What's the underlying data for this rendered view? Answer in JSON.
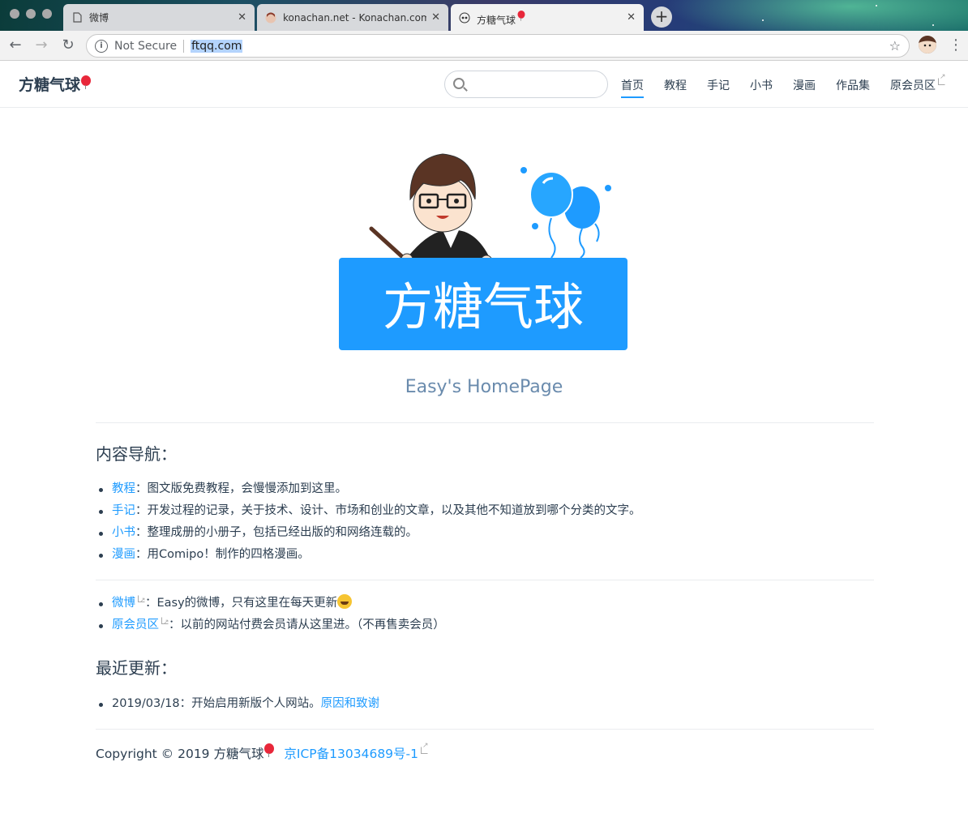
{
  "browser": {
    "tabs": [
      {
        "title": "微博",
        "active": false
      },
      {
        "title": "konachan.net - Konachan.com",
        "active": false
      },
      {
        "title": "方糖气球",
        "active": true
      }
    ],
    "security_label": "Not Secure",
    "url": "ftqq.com"
  },
  "header": {
    "site_title": "方糖气球",
    "search_placeholder": "",
    "nav": [
      {
        "label": "首页",
        "active": true,
        "external": false
      },
      {
        "label": "教程",
        "active": false,
        "external": false
      },
      {
        "label": "手记",
        "active": false,
        "external": false
      },
      {
        "label": "小书",
        "active": false,
        "external": false
      },
      {
        "label": "漫画",
        "active": false,
        "external": false
      },
      {
        "label": "作品集",
        "active": false,
        "external": false
      },
      {
        "label": "原会员区",
        "active": false,
        "external": true
      }
    ]
  },
  "hero": {
    "logo_text": "方糖气球",
    "tagline": "Easy's HomePage"
  },
  "content_nav": {
    "title": "内容导航：",
    "items": [
      {
        "link": "教程",
        "text": "：图文版免费教程，会慢慢添加到这里。"
      },
      {
        "link": "手记",
        "text": "：开发过程的记录，关于技术、设计、市场和创业的文章，以及其他不知道放到哪个分类的文字。"
      },
      {
        "link": "小书",
        "text": "：整理成册的小册子，包括已经出版的和网络连载的。"
      },
      {
        "link": "漫画",
        "text": "：用Comipo！制作的四格漫画。"
      }
    ],
    "external_items": [
      {
        "link": "微博",
        "text": "：Easy的微博，只有这里在每天更新"
      },
      {
        "link": "原会员区",
        "text": "：以前的网站付费会员请从这里进。（不再售卖会员）"
      }
    ]
  },
  "updates": {
    "title": "最近更新：",
    "items": [
      {
        "text": "2019/03/18：开始启用新版个人网站。",
        "link": "原因和致谢"
      }
    ]
  },
  "footer": {
    "copyright": "Copyright © 2019 方糖气球",
    "icp": "京ICP备13034689号-1"
  },
  "colors": {
    "accent": "#1e9bff",
    "text": "#2c3e50",
    "tagline": "#6a8bad"
  }
}
